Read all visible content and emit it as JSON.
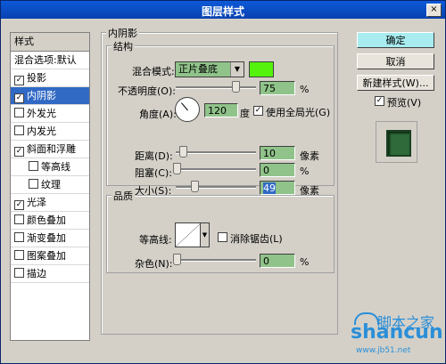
{
  "window": {
    "title": "图层样式",
    "close_glyph": "×"
  },
  "sidebar": {
    "header": "样式",
    "items": [
      {
        "label": "混合选项:默认",
        "checkbox": false,
        "checked": false,
        "selected": false,
        "sub": false
      },
      {
        "label": "投影",
        "checkbox": true,
        "checked": true,
        "selected": false,
        "sub": false
      },
      {
        "label": "内阴影",
        "checkbox": true,
        "checked": true,
        "selected": true,
        "sub": false
      },
      {
        "label": "外发光",
        "checkbox": true,
        "checked": false,
        "selected": false,
        "sub": false
      },
      {
        "label": "内发光",
        "checkbox": true,
        "checked": false,
        "selected": false,
        "sub": false
      },
      {
        "label": "斜面和浮雕",
        "checkbox": true,
        "checked": true,
        "selected": false,
        "sub": false
      },
      {
        "label": "等高线",
        "checkbox": true,
        "checked": false,
        "selected": false,
        "sub": true
      },
      {
        "label": "纹理",
        "checkbox": true,
        "checked": false,
        "selected": false,
        "sub": true
      },
      {
        "label": "光泽",
        "checkbox": true,
        "checked": true,
        "selected": false,
        "sub": false
      },
      {
        "label": "颜色叠加",
        "checkbox": true,
        "checked": false,
        "selected": false,
        "sub": false
      },
      {
        "label": "渐变叠加",
        "checkbox": true,
        "checked": false,
        "selected": false,
        "sub": false
      },
      {
        "label": "图案叠加",
        "checkbox": true,
        "checked": false,
        "selected": false,
        "sub": false
      },
      {
        "label": "描边",
        "checkbox": true,
        "checked": false,
        "selected": false,
        "sub": false
      }
    ]
  },
  "panel": {
    "title": "内阴影",
    "structure": {
      "title": "结构",
      "blend_mode_label": "混合模式:",
      "blend_mode_value": "正片叠底",
      "blend_color": "#54f20c",
      "opacity_label": "不透明度(O):",
      "opacity_value": "75",
      "opacity_unit": "%",
      "opacity_fraction": 0.75,
      "angle_label": "角度(A):",
      "angle_value": "120",
      "angle_unit": "度",
      "global_light_label": "使用全局光(G)",
      "global_light_checked": true,
      "distance_label": "距离(D):",
      "distance_value": "10",
      "distance_unit": "像素",
      "choke_label": "阻塞(C):",
      "choke_value": "0",
      "choke_unit": "%",
      "size_label": "大小(S):",
      "size_value": "49",
      "size_unit": "像素"
    },
    "quality": {
      "title": "品质",
      "contour_label": "等高线:",
      "antialias_label": "消除锯齿(L)",
      "antialias_checked": false,
      "noise_label": "杂色(N):",
      "noise_value": "0",
      "noise_unit": "%"
    }
  },
  "buttons": {
    "ok": "确定",
    "cancel": "取消",
    "new_style": "新建样式(W)...",
    "preview_label": "预览(V)",
    "preview_checked": true
  },
  "watermark": {
    "main": "shancun",
    "cn": "脚本之家",
    "url": "www.jb51.net"
  }
}
